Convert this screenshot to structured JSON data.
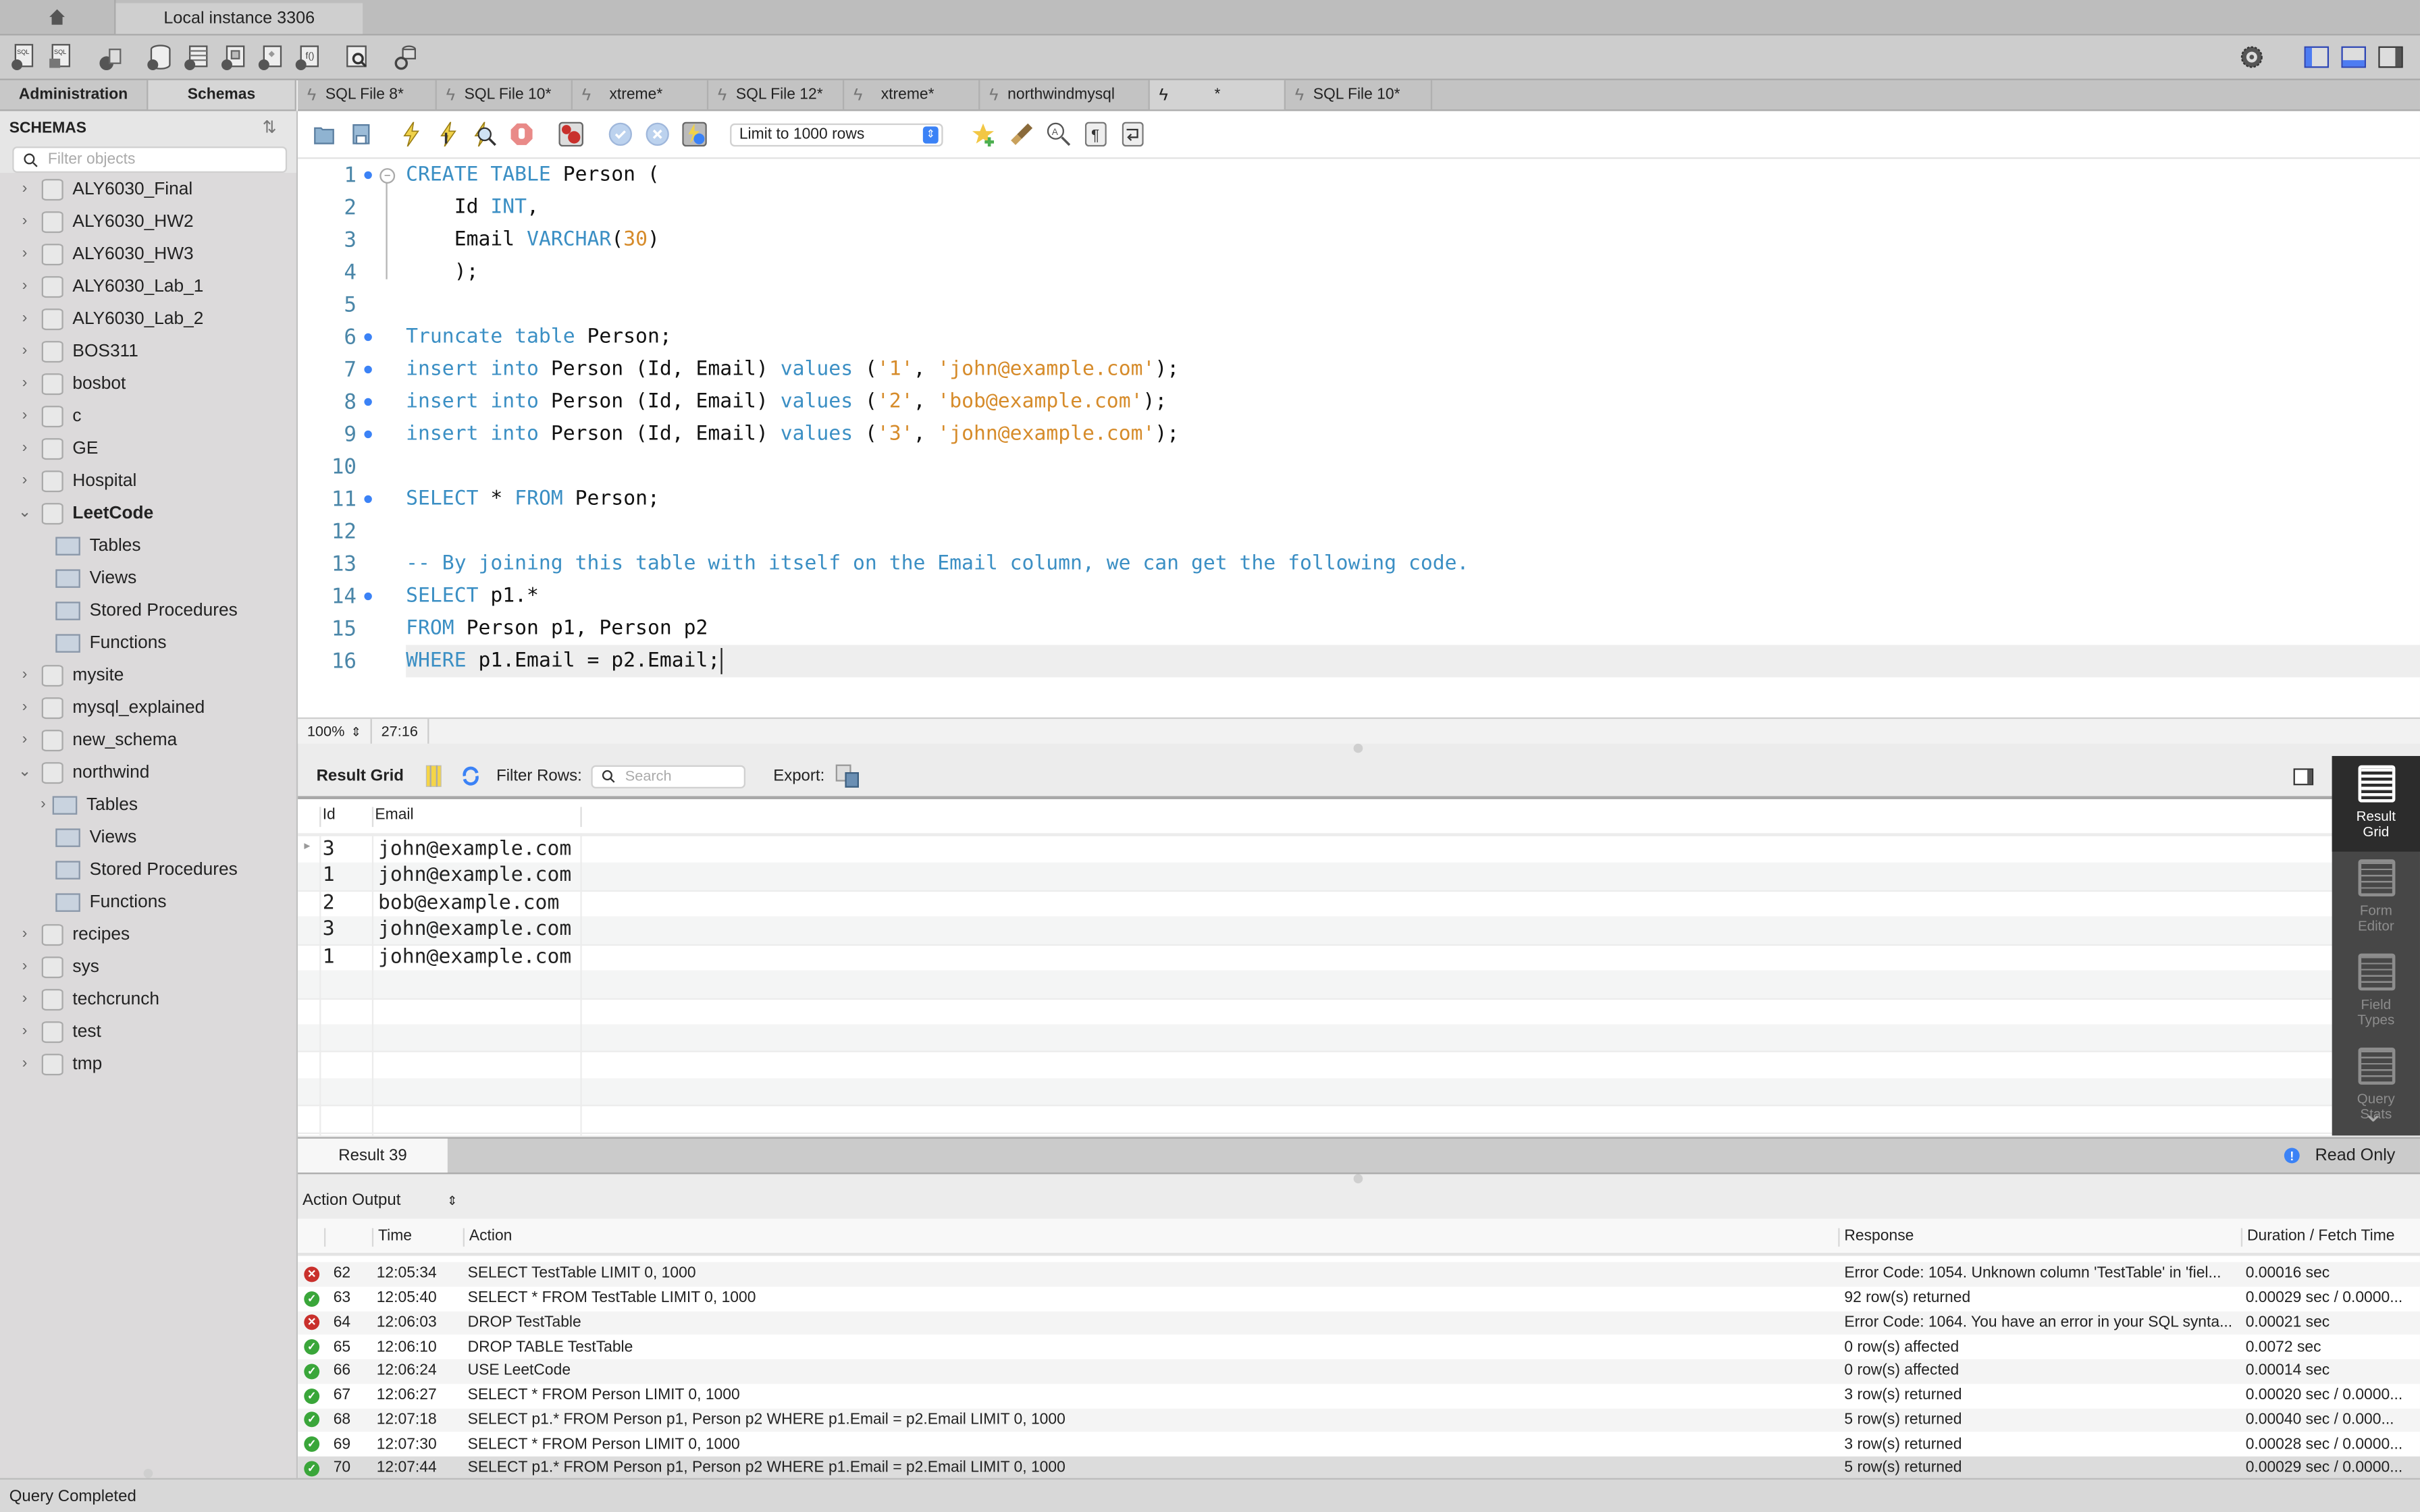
{
  "window": {
    "home_icon": "home-icon",
    "instance_tab": "Local instance 3306"
  },
  "main_toolbar": {
    "icons": [
      "new-sql-tab-icon",
      "open-sql-script-icon",
      "server-info-icon",
      "create-schema-icon",
      "create-table-icon",
      "create-view-icon",
      "create-procedure-icon",
      "create-function-icon",
      "search-table-data-icon",
      "reconnect-icon"
    ],
    "right_icons": [
      "settings-gear-icon",
      "toggle-sidebar-icon",
      "toggle-output-panel-icon",
      "toggle-secondary-sidebar-icon"
    ]
  },
  "side_tabs": [
    {
      "label": "Administration",
      "active": false
    },
    {
      "label": "Schemas",
      "active": true
    }
  ],
  "editor_tabs": [
    {
      "label": "SQL File 8*",
      "active": false
    },
    {
      "label": "SQL File 10*",
      "active": false
    },
    {
      "label": "xtreme*",
      "active": false
    },
    {
      "label": "SQL File 12*",
      "active": false
    },
    {
      "label": "xtreme*",
      "active": false
    },
    {
      "label": "northwindmysql",
      "active": false
    },
    {
      "label": "*",
      "active": true
    },
    {
      "label": "SQL File 10*",
      "active": false
    }
  ],
  "sidebar": {
    "title": "SCHEMAS",
    "filter_placeholder": "Filter objects",
    "tree": [
      {
        "label": "ALY6030_Final",
        "level": 0,
        "expanded": false
      },
      {
        "label": "ALY6030_HW2",
        "level": 0,
        "expanded": false
      },
      {
        "label": "ALY6030_HW3",
        "level": 0,
        "expanded": false
      },
      {
        "label": "ALY6030_Lab_1",
        "level": 0,
        "expanded": false
      },
      {
        "label": "ALY6030_Lab_2",
        "level": 0,
        "expanded": false
      },
      {
        "label": "BOS311",
        "level": 0,
        "expanded": false
      },
      {
        "label": "bosbot",
        "level": 0,
        "expanded": false
      },
      {
        "label": "c",
        "level": 0,
        "expanded": false
      },
      {
        "label": "GE",
        "level": 0,
        "expanded": false
      },
      {
        "label": "Hospital",
        "level": 0,
        "expanded": false
      },
      {
        "label": "LeetCode",
        "level": 0,
        "expanded": true,
        "bold": true
      },
      {
        "label": "Tables",
        "level": 1
      },
      {
        "label": "Views",
        "level": 1
      },
      {
        "label": "Stored Procedures",
        "level": 1
      },
      {
        "label": "Functions",
        "level": 1
      },
      {
        "label": "mysite",
        "level": 0,
        "expanded": false
      },
      {
        "label": "mysql_explained",
        "level": 0,
        "expanded": false
      },
      {
        "label": "new_schema",
        "level": 0,
        "expanded": false
      },
      {
        "label": "northwind",
        "level": 0,
        "expanded": true
      },
      {
        "label": "Tables",
        "level": 1,
        "expandable": true
      },
      {
        "label": "Views",
        "level": 1
      },
      {
        "label": "Stored Procedures",
        "level": 1
      },
      {
        "label": "Functions",
        "level": 1
      },
      {
        "label": "recipes",
        "level": 0,
        "expanded": false
      },
      {
        "label": "sys",
        "level": 0,
        "expanded": false
      },
      {
        "label": "techcrunch",
        "level": 0,
        "expanded": false
      },
      {
        "label": "test",
        "level": 0,
        "expanded": false
      },
      {
        "label": "tmp",
        "level": 0,
        "expanded": false
      }
    ]
  },
  "editor_toolbar": {
    "icons": [
      "open-file-icon",
      "save-icon",
      "execute-icon",
      "execute-current-statement-icon",
      "explain-icon",
      "stop-icon",
      "toggle-stop-on-error-icon",
      "commit-icon",
      "rollback-icon",
      "autocommit-icon"
    ],
    "limit_select": "Limit to 1000 rows",
    "right_icons": [
      "add-snippet-icon",
      "beautify-icon",
      "find-icon",
      "invisible-chars-icon",
      "word-wrap-icon"
    ]
  },
  "editor": {
    "lines": [
      {
        "n": "1",
        "dot": true,
        "tokens": [
          [
            "kw",
            "CREATE TABLE"
          ],
          [
            "",
            " Person ("
          ]
        ]
      },
      {
        "n": "2",
        "dot": false,
        "tokens": [
          [
            "",
            "    Id "
          ],
          [
            "kw",
            "INT"
          ],
          [
            "",
            ","
          ]
        ]
      },
      {
        "n": "3",
        "dot": false,
        "tokens": [
          [
            "",
            "    Email "
          ],
          [
            "kw",
            "VARCHAR"
          ],
          [
            "",
            "("
          ],
          [
            "str",
            "30"
          ],
          [
            "",
            ")"
          ]
        ]
      },
      {
        "n": "4",
        "dot": false,
        "tokens": [
          [
            "",
            "    );"
          ]
        ]
      },
      {
        "n": "5",
        "dot": false,
        "tokens": []
      },
      {
        "n": "6",
        "dot": true,
        "tokens": [
          [
            "kw",
            "Truncate table"
          ],
          [
            "",
            " Person;"
          ]
        ]
      },
      {
        "n": "7",
        "dot": true,
        "tokens": [
          [
            "kw",
            "insert into"
          ],
          [
            "",
            " Person (Id, Email) "
          ],
          [
            "kw",
            "values"
          ],
          [
            "",
            " ("
          ],
          [
            "str",
            "'1'"
          ],
          [
            "",
            ", "
          ],
          [
            "str",
            "'john@example.com'"
          ],
          [
            "",
            ");"
          ]
        ]
      },
      {
        "n": "8",
        "dot": true,
        "tokens": [
          [
            "kw",
            "insert into"
          ],
          [
            "",
            " Person (Id, Email) "
          ],
          [
            "kw",
            "values"
          ],
          [
            "",
            " ("
          ],
          [
            "str",
            "'2'"
          ],
          [
            "",
            ", "
          ],
          [
            "str",
            "'bob@example.com'"
          ],
          [
            "",
            ");"
          ]
        ]
      },
      {
        "n": "9",
        "dot": true,
        "tokens": [
          [
            "kw",
            "insert into"
          ],
          [
            "",
            " Person (Id, Email) "
          ],
          [
            "kw",
            "values"
          ],
          [
            "",
            " ("
          ],
          [
            "str",
            "'3'"
          ],
          [
            "",
            ", "
          ],
          [
            "str",
            "'john@example.com'"
          ],
          [
            "",
            ");"
          ]
        ]
      },
      {
        "n": "10",
        "dot": false,
        "tokens": []
      },
      {
        "n": "11",
        "dot": true,
        "tokens": [
          [
            "kw",
            "SELECT"
          ],
          [
            "",
            " * "
          ],
          [
            "kw",
            "FROM"
          ],
          [
            "",
            " Person;"
          ]
        ]
      },
      {
        "n": "12",
        "dot": false,
        "tokens": []
      },
      {
        "n": "13",
        "dot": false,
        "tokens": [
          [
            "cmt",
            "-- By joining this table with itself on the Email column, we can get the following code."
          ]
        ]
      },
      {
        "n": "14",
        "dot": true,
        "tokens": [
          [
            "kw",
            "SELECT"
          ],
          [
            "",
            " p1.*"
          ]
        ]
      },
      {
        "n": "15",
        "dot": false,
        "tokens": [
          [
            "kw",
            "FROM"
          ],
          [
            "",
            " Person p1, Person p2"
          ]
        ]
      },
      {
        "n": "16",
        "dot": false,
        "current": true,
        "tokens": [
          [
            "kw",
            "WHERE"
          ],
          [
            "",
            " p1.Email = p2.Email;"
          ]
        ]
      }
    ],
    "zoom": "100%",
    "cursor_pos": "27:16"
  },
  "result_toolbar": {
    "title": "Result Grid",
    "filter_label": "Filter Rows:",
    "search_placeholder": "Search",
    "export_label": "Export:"
  },
  "result_grid": {
    "columns": [
      "Id",
      "Email"
    ],
    "rows": [
      [
        "3",
        "john@example.com"
      ],
      [
        "1",
        "john@example.com"
      ],
      [
        "2",
        "bob@example.com"
      ],
      [
        "3",
        "john@example.com"
      ],
      [
        "1",
        "john@example.com"
      ]
    ]
  },
  "right_panel": [
    {
      "label": "Result Grid",
      "active": true
    },
    {
      "label": "Form Editor",
      "active": false
    },
    {
      "label": "Field Types",
      "active": false
    },
    {
      "label": "Query Stats",
      "active": false
    }
  ],
  "result_tabs": {
    "tab": "Result 39",
    "read_only": "Read Only"
  },
  "action_output": {
    "selector": "Action Output",
    "columns": [
      "",
      "Time",
      "Action",
      "Response",
      "Duration / Fetch Time"
    ],
    "rows": [
      {
        "status": "error",
        "n": "62",
        "time": "12:05:34",
        "action": "SELECT TestTable LIMIT 0, 1000",
        "response": "Error Code: 1054. Unknown column 'TestTable' in 'fiel...",
        "duration": "0.00016 sec"
      },
      {
        "status": "ok",
        "n": "63",
        "time": "12:05:40",
        "action": "SELECT * FROM TestTable LIMIT 0, 1000",
        "response": "92 row(s) returned",
        "duration": "0.00029 sec / 0.0000..."
      },
      {
        "status": "error",
        "n": "64",
        "time": "12:06:03",
        "action": "DROP TestTable",
        "response": "Error Code: 1064. You have an error in your SQL synta...",
        "duration": "0.00021 sec"
      },
      {
        "status": "ok",
        "n": "65",
        "time": "12:06:10",
        "action": "DROP TABLE TestTable",
        "response": "0 row(s) affected",
        "duration": "0.0072 sec"
      },
      {
        "status": "ok",
        "n": "66",
        "time": "12:06:24",
        "action": "USE LeetCode",
        "response": "0 row(s) affected",
        "duration": "0.00014 sec"
      },
      {
        "status": "ok",
        "n": "67",
        "time": "12:06:27",
        "action": "SELECT * FROM Person LIMIT 0, 1000",
        "response": "3 row(s) returned",
        "duration": "0.00020 sec / 0.0000..."
      },
      {
        "status": "ok",
        "n": "68",
        "time": "12:07:18",
        "action": "SELECT p1.* FROM Person p1, Person p2 WHERE p1.Email = p2.Email LIMIT 0, 1000",
        "response": "5 row(s) returned",
        "duration": "0.00040 sec / 0.000..."
      },
      {
        "status": "ok",
        "n": "69",
        "time": "12:07:30",
        "action": "SELECT * FROM Person LIMIT 0, 1000",
        "response": "3 row(s) returned",
        "duration": "0.00028 sec / 0.0000..."
      },
      {
        "status": "ok",
        "n": "70",
        "time": "12:07:44",
        "action": "SELECT p1.* FROM Person p1, Person p2 WHERE p1.Email = p2.Email LIMIT 0, 1000",
        "response": "5 row(s) returned",
        "duration": "0.00029 sec / 0.0000...",
        "selected": true
      }
    ]
  },
  "status_bar": {
    "text": "Query Completed"
  },
  "colors": {
    "keyword": "#3b8fc4",
    "string": "#d68b2a",
    "line_number": "#4a86a8",
    "accent": "#3b82f6",
    "ok": "#3aa63a",
    "error": "#c9302c"
  }
}
